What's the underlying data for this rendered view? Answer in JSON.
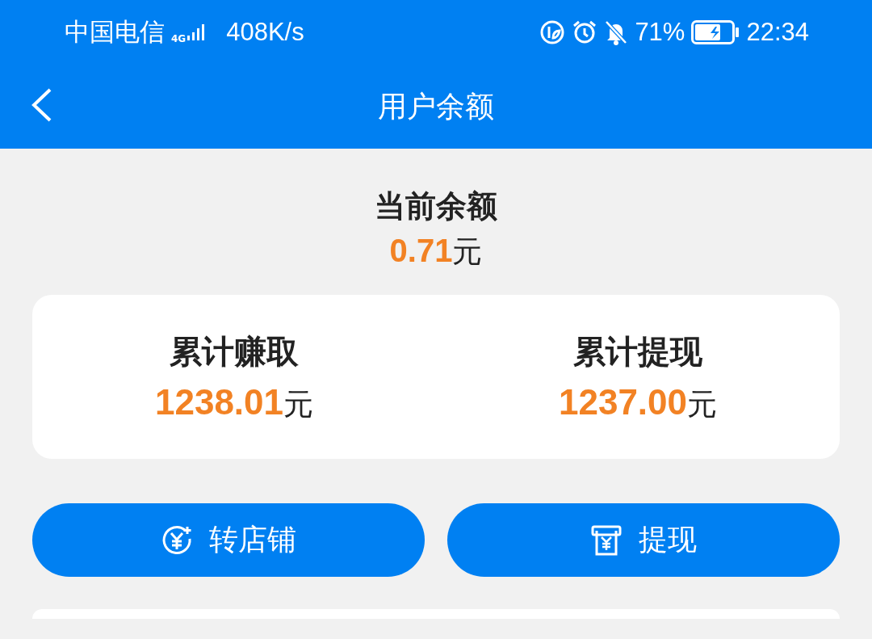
{
  "status_bar": {
    "carrier": "中国电信",
    "network": "4G",
    "speed": "408K/s",
    "battery": "71%",
    "time": "22:34"
  },
  "header": {
    "title": "用户余额"
  },
  "balance": {
    "label": "当前余额",
    "amount": "0.71",
    "unit": "元"
  },
  "stats": [
    {
      "label": "累计赚取",
      "amount": "1238.01",
      "unit": "元"
    },
    {
      "label": "累计提现",
      "amount": "1237.00",
      "unit": "元"
    }
  ],
  "actions": [
    {
      "kind": "transfer",
      "label": "转店铺"
    },
    {
      "kind": "withdraw",
      "label": "提现"
    }
  ]
}
